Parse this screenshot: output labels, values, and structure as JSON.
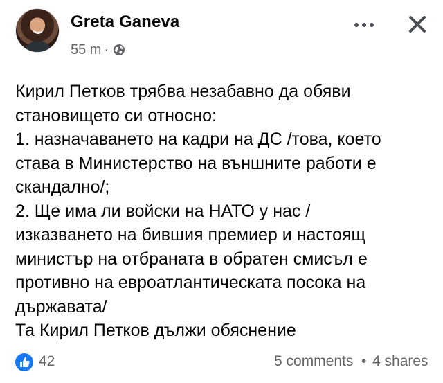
{
  "post": {
    "author": "Greta Ganeva",
    "time": "55 m",
    "separator": "·",
    "privacy_icon": "globe-icon",
    "text": "Кирил Петков трябва незабавно да обяви\nстановището си относно:\n1. назначаването на кадри на ДС /това, което\nстава в Министерство на външните работи е\nскандално/;\n2. Ще има ли войски на НАТО у нас /\nизказването на бившия премиер и настоящ\nминистър на отбраната в обратен смисъл е\nпротивно на евроатлантическата посока на\nдържавата/\nТа Кирил Петков дължи обяснение"
  },
  "footer": {
    "reactions_count": "42",
    "comments": "5 comments",
    "dot": "•",
    "shares": "4 shares"
  },
  "icons": {
    "more": "more-options-icon",
    "close": "close-icon",
    "like": "like-icon"
  },
  "colors": {
    "accent": "#1877f2",
    "secondary_text": "#65676b",
    "primary_text": "#050505"
  }
}
